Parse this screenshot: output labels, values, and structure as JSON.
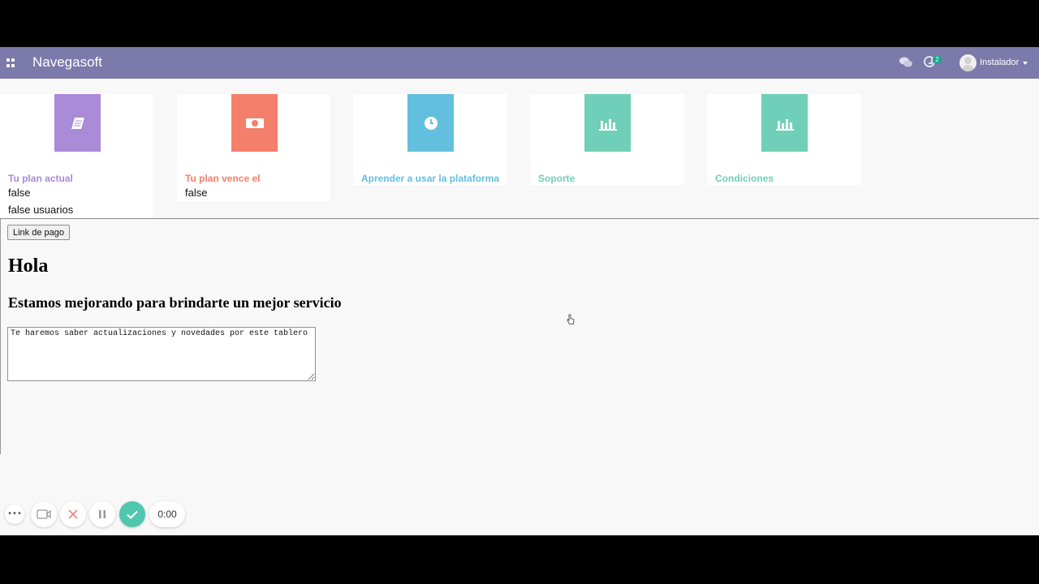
{
  "topbar": {
    "brand": "Navegasoft",
    "activity_count": "2",
    "user_name": "Instalador",
    "background": "#7c79ab"
  },
  "cards": [
    {
      "title": "Tu plan actual",
      "icon": "book-icon",
      "color": "#a98bd8",
      "values": [
        "false",
        "false usuarios"
      ]
    },
    {
      "title": "Tu plan vence el",
      "icon": "money-icon",
      "color": "#f47f6a",
      "values": [
        "false"
      ]
    },
    {
      "title": "Aprender a usar la plataforma",
      "icon": "clock-icon",
      "color": "#63bfde",
      "values": []
    },
    {
      "title": "Soporte",
      "icon": "bar-chart-icon",
      "color": "#6fcfb8",
      "values": []
    },
    {
      "title": "Condiciones",
      "icon": "bar-chart-icon",
      "color": "#6fcfb8",
      "values": []
    }
  ],
  "main": {
    "pay_button": "Link de pago",
    "heading": "Hola",
    "subheading": "Estamos mejorando para brindarte un mejor servicio",
    "textarea_value": "Te haremos saber actualizaciones y novedades por este tablero"
  },
  "recorder": {
    "timer": "0:00",
    "buttons": [
      "more-icon",
      "camera-icon",
      "cancel-icon",
      "pause-icon",
      "done-icon"
    ]
  }
}
